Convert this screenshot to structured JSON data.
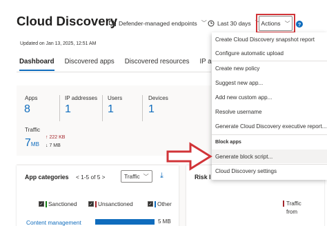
{
  "header": {
    "title": "Cloud Discovery",
    "endpoints_filter": "Defender-managed endpoints",
    "date_filter": "Last 30 days",
    "actions_label": "Actions",
    "help_glyph": "?"
  },
  "updated_text": "Updated on Jan 13, 2025, 12:51 AM",
  "tabs": [
    {
      "label": "Dashboard",
      "active": true
    },
    {
      "label": "Discovered apps",
      "active": false
    },
    {
      "label": "Discovered resources",
      "active": false
    },
    {
      "label": "IP addre",
      "active": false
    }
  ],
  "stats": {
    "apps": {
      "label": "Apps",
      "value": "8"
    },
    "ip": {
      "label": "IP addresses",
      "value": "1"
    },
    "users": {
      "label": "Users",
      "value": "1"
    },
    "devices": {
      "label": "Devices",
      "value": "1"
    },
    "traffic": {
      "label": "Traffic",
      "value": "7",
      "unit": "MB",
      "upload": "222 KB",
      "download": "7 MB"
    }
  },
  "app_categories": {
    "title": "App categories",
    "pager": "1-5 of 5",
    "select_value": "Traffic",
    "legend": [
      {
        "label": "Sanctioned",
        "color": "#107c10"
      },
      {
        "label": "Unsanctioned",
        "color": "#a4262c"
      },
      {
        "label": "Other",
        "color": "#0f6cbd"
      }
    ],
    "rows": [
      {
        "label": "Content management",
        "value": "5 MB",
        "fraction": 0.97
      }
    ]
  },
  "risk_card": {
    "title": "Risk l",
    "legend_lines": [
      "Traffic",
      "from"
    ]
  },
  "actions_menu": {
    "items_top": [
      "Create Cloud Discovery snapshot report",
      "Configure automatic upload",
      "Create new policy",
      "Suggest new app...",
      "Add new custom app...",
      "Resolve username",
      "Generate Cloud Discovery executive report..."
    ],
    "section": "Block apps",
    "block_item": "Generate block script...",
    "settings_item": "Cloud Discovery settings"
  },
  "colors": {
    "accent": "#0f6cbd",
    "highlight": "#d13438"
  }
}
